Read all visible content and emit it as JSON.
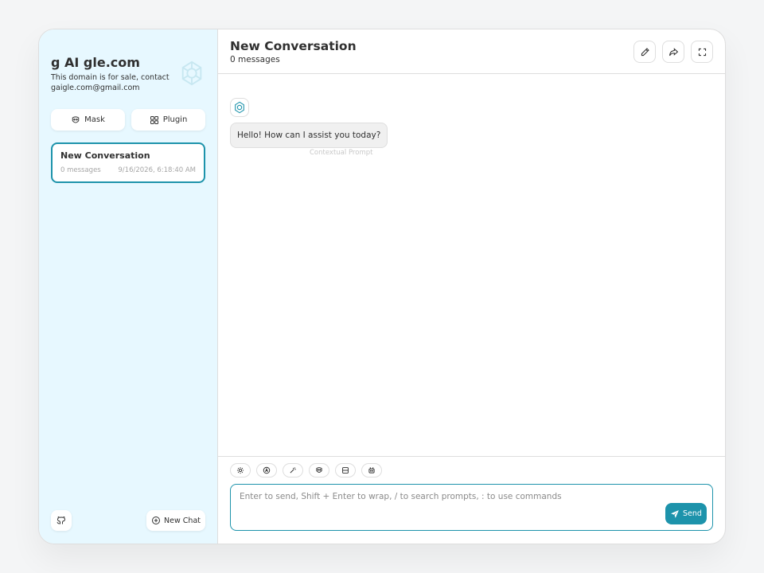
{
  "sidebar": {
    "title": "g AI gle.com",
    "subtitle": "This domain is for sale, contact gaigle.com@gmail.com",
    "logo_icon": "openai-logo-icon",
    "mask_label": "Mask",
    "plugin_label": "Plugin",
    "chats": [
      {
        "title": "New Conversation",
        "count": "0 messages",
        "date": "9/16/2026, 6:18:40 AM"
      }
    ],
    "github_icon": "github-icon",
    "new_chat_label": "New Chat"
  },
  "header": {
    "title": "New Conversation",
    "subtitle": "0 messages",
    "buttons": [
      "edit-icon",
      "share-icon",
      "fullscreen-icon"
    ]
  },
  "messages": [
    {
      "role": "assistant",
      "text": "Hello! How can I assist you today?",
      "note": "Contextual Prompt"
    }
  ],
  "input": {
    "placeholder": "Enter to send, Shift + Enter to wrap, / to search prompts, : to use commands",
    "tools": [
      "settings-icon",
      "theme-icon",
      "prompt-icon",
      "mask-icon",
      "clear-context-icon",
      "model-icon"
    ],
    "send_label": "Send"
  },
  "colors": {
    "accent": "#1d93ab",
    "sidebar_bg": "#e7f8ff",
    "border": "#dedede"
  }
}
